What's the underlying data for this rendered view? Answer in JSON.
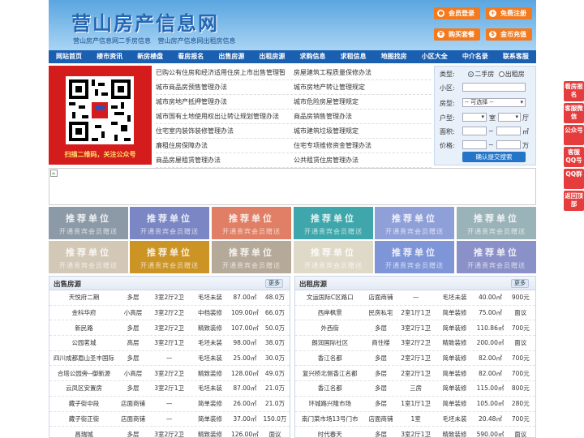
{
  "header": {
    "title": "营山房产信息网",
    "subtitles": [
      "营山房产信息网二手房信息",
      "营山房产信息网出租房信息"
    ],
    "buttons": [
      {
        "label": "会员登录",
        "icon": "user-icon"
      },
      {
        "label": "免费注册",
        "icon": "register-icon"
      },
      {
        "label": "购买套餐",
        "icon": "package-icon"
      },
      {
        "label": "金币充值",
        "icon": "coin-icon"
      }
    ]
  },
  "nav": [
    "网站首页",
    "楼市资讯",
    "新房楼盘",
    "看房报名",
    "出售房源",
    "出租房源",
    "求购信息",
    "求租信息",
    "地图找房",
    "小区大全",
    "中介名录",
    "联系客服"
  ],
  "qr": {
    "caption": "扫描二维码，关注公众号"
  },
  "links": [
    [
      "已购公有住房和经济适用住房上市出售管理暂",
      "房屋建筑工程质量保修办法"
    ],
    [
      "城市商品房预售管理办法",
      "城市房地产转让管理规定"
    ],
    [
      "城市房地产抵押管理办法",
      "城市危险房屋管理规定"
    ],
    [
      "城市国有土地使用权出让转让规划管理办法",
      "商品房销售管理办法"
    ],
    [
      "住宅室内装饰装修管理办法",
      "城市建筑垃圾管理规定"
    ],
    [
      "廉租住房保障办法",
      "住宅专项维修资金管理办法"
    ],
    [
      "商品房屋租赁管理办法",
      "公共租赁住房管理办法"
    ]
  ],
  "search": {
    "type_label": "类型:",
    "type_options": [
      "二手房",
      "出租房"
    ],
    "community_label": "小区:",
    "house_type_label": "房型:",
    "house_type_value": "-- 可选择 --",
    "layout_label": "户型:",
    "room_unit": "室",
    "hall_unit": "厅",
    "area_label": "面积:",
    "area_unit": "㎡",
    "price_label": "价格:",
    "price_sep": "~",
    "price_unit": "万",
    "submit": "确认提交搜索"
  },
  "tiles": {
    "line1": "推荐单位",
    "line2": "开通贵宾会员赠送",
    "colors": [
      "#8c9aa8",
      "#7b87c4",
      "#e07f65",
      "#3fa7ab",
      "#8f9fd8",
      "#9ab3b8",
      "#d2c8b5",
      "#cc9424",
      "#b5a999",
      "#dfd9c8",
      "#7e95d8",
      "#8a90c8"
    ]
  },
  "sale": {
    "title": "出售房源",
    "more": "更多",
    "rows": [
      [
        "天悦府二期",
        "多层",
        "3室2厅2卫",
        "毛坯未装",
        "87.00㎡",
        "48.0万"
      ],
      [
        "金科华府",
        "小高层",
        "3室2厅2卫",
        "中档装修",
        "109.00㎡",
        "66.0万"
      ],
      [
        "新民路",
        "多层",
        "3室2厅2卫",
        "精致装修",
        "107.00㎡",
        "50.0万"
      ],
      [
        "公园茗城",
        "高层",
        "3室2厅1卫",
        "毛坯未装",
        "98.00㎡",
        "38.0万"
      ],
      [
        "四川成都眉山圣丰国际",
        "多层",
        "—",
        "毛坯未装",
        "25.00㎡",
        "30.0万"
      ],
      [
        "合塔公园旁--御新源",
        "小高层",
        "3室2厅2卫",
        "精致装修",
        "128.00㎡",
        "49.0万"
      ],
      [
        "云凤区安置房",
        "多层",
        "3室2厅1卫",
        "毛坯未装",
        "87.00㎡",
        "21.0万"
      ],
      [
        "藏子街中段",
        "店面商铺",
        "—",
        "简单装修",
        "26.00㎡",
        "21.0万"
      ],
      [
        "藏子街正街",
        "店面商铺",
        "—",
        "简单装修",
        "37.00㎡",
        "150.0万"
      ],
      [
        "昌瑞城",
        "多层",
        "3室2厅2卫",
        "精致装修",
        "126.00㎡",
        "面议"
      ]
    ]
  },
  "rent": {
    "title": "出租房源",
    "more": "更多",
    "rows": [
      [
        "文运国际C区路口",
        "店面商铺",
        "—",
        "毛坯未装",
        "40.00㎡",
        "900元"
      ],
      [
        "西岸枫景",
        "民房私宅",
        "2室1厅1卫",
        "简单装修",
        "75.00㎡",
        "面议"
      ],
      [
        "外西街",
        "多层",
        "3室2厅1卫",
        "简单装修",
        "110.86㎡",
        "700元"
      ],
      [
        "朗润国际社区",
        "商住楼",
        "3室2厅2卫",
        "精致装修",
        "200.00㎡",
        "面议"
      ],
      [
        "香江名都",
        "多层",
        "2室2厅1卫",
        "简单装修",
        "82.00㎡",
        "700元"
      ],
      [
        "复兴桥北侧香江名都",
        "多层",
        "2室2厅1卫",
        "简单装修",
        "82.00㎡",
        "700元"
      ],
      [
        "香江名都",
        "多层",
        "三房",
        "简单装修",
        "115.00㎡",
        "800元"
      ],
      [
        "环城路兴隆市场",
        "多层",
        "1室1厅1卫",
        "简单装修",
        "105.00㎡",
        "280元"
      ],
      [
        "南门菜市场13号门市",
        "店面商铺",
        "1室",
        "毛坯未装",
        "20.48㎡",
        "700元"
      ],
      [
        "时代春天",
        "多层",
        "3室2厅1卫",
        "精致装修",
        "590.00㎡",
        "面议"
      ]
    ]
  },
  "side": [
    "看房报名",
    "客服微信",
    "公众号",
    "客服QQ号",
    "QQ群",
    "返回顶部"
  ]
}
